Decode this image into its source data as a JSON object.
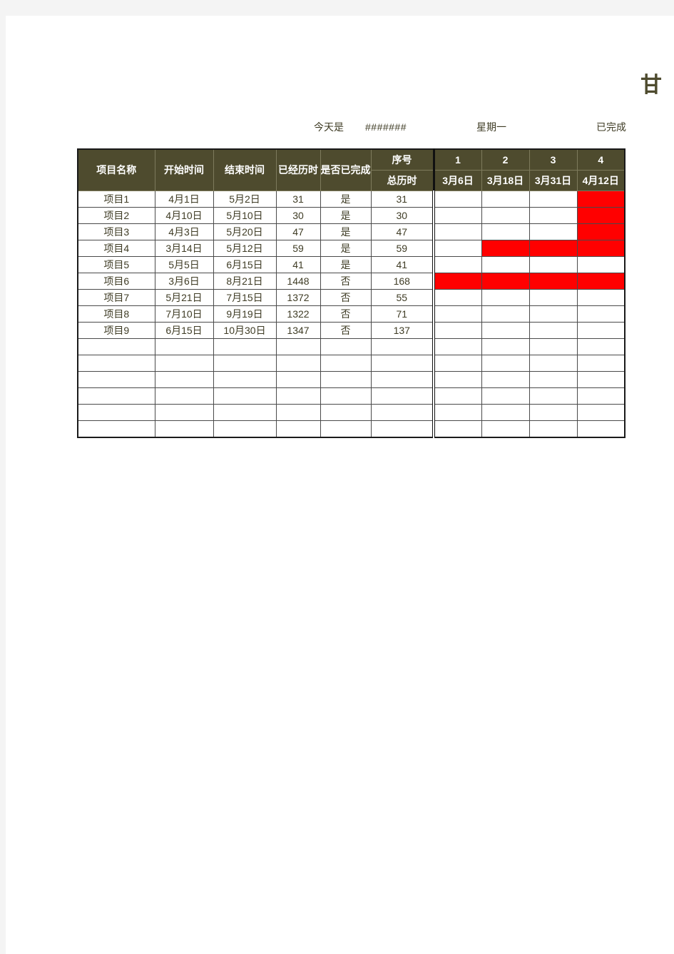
{
  "title": "甘",
  "info": {
    "today_label": "今天是",
    "today_value": "#######",
    "weekday": "星期一",
    "legend_done": "已完成"
  },
  "table": {
    "headers_top": [
      "项目名称",
      "开始时间",
      "结束时间",
      "已经历时",
      "是否已完成",
      "序号"
    ],
    "header_total_label": "总历时",
    "gantt_index": [
      "1",
      "2",
      "3",
      "4"
    ],
    "gantt_dates": [
      "3月6日",
      "3月18日",
      "3月31日",
      "4月12日"
    ],
    "rows": [
      {
        "name": "项目1",
        "start": "4月1日",
        "end": "5月2日",
        "elapsed": "31",
        "done": "是",
        "total": "31",
        "bars": [
          0,
          0,
          0,
          1
        ]
      },
      {
        "name": "项目2",
        "start": "4月10日",
        "end": "5月10日",
        "elapsed": "30",
        "done": "是",
        "total": "30",
        "bars": [
          0,
          0,
          0,
          1
        ]
      },
      {
        "name": "项目3",
        "start": "4月3日",
        "end": "5月20日",
        "elapsed": "47",
        "done": "是",
        "total": "47",
        "bars": [
          0,
          0,
          0,
          1
        ]
      },
      {
        "name": "项目4",
        "start": "3月14日",
        "end": "5月12日",
        "elapsed": "59",
        "done": "是",
        "total": "59",
        "bars": [
          0,
          1,
          1,
          1
        ]
      },
      {
        "name": "项目5",
        "start": "5月5日",
        "end": "6月15日",
        "elapsed": "41",
        "done": "是",
        "total": "41",
        "bars": [
          0,
          0,
          0,
          0
        ]
      },
      {
        "name": "项目6",
        "start": "3月6日",
        "end": "8月21日",
        "elapsed": "1448",
        "done": "否",
        "total": "168",
        "bars": [
          1,
          1,
          1,
          1
        ]
      },
      {
        "name": "项目7",
        "start": "5月21日",
        "end": "7月15日",
        "elapsed": "1372",
        "done": "否",
        "total": "55",
        "bars": [
          0,
          0,
          0,
          0
        ]
      },
      {
        "name": "项目8",
        "start": "7月10日",
        "end": "9月19日",
        "elapsed": "1322",
        "done": "否",
        "total": "71",
        "bars": [
          0,
          0,
          0,
          0
        ]
      },
      {
        "name": "项目9",
        "start": "6月15日",
        "end": "10月30日",
        "elapsed": "1347",
        "done": "否",
        "total": "137",
        "bars": [
          0,
          0,
          0,
          0
        ]
      },
      {
        "name": "",
        "start": "",
        "end": "",
        "elapsed": "",
        "done": "",
        "total": "",
        "bars": [
          0,
          0,
          0,
          0
        ]
      },
      {
        "name": "",
        "start": "",
        "end": "",
        "elapsed": "",
        "done": "",
        "total": "",
        "bars": [
          0,
          0,
          0,
          0
        ]
      },
      {
        "name": "",
        "start": "",
        "end": "",
        "elapsed": "",
        "done": "",
        "total": "",
        "bars": [
          0,
          0,
          0,
          0
        ]
      },
      {
        "name": "",
        "start": "",
        "end": "",
        "elapsed": "",
        "done": "",
        "total": "",
        "bars": [
          0,
          0,
          0,
          0
        ]
      },
      {
        "name": "",
        "start": "",
        "end": "",
        "elapsed": "",
        "done": "",
        "total": "",
        "bars": [
          0,
          0,
          0,
          0
        ]
      },
      {
        "name": "",
        "start": "",
        "end": "",
        "elapsed": "",
        "done": "",
        "total": "",
        "bars": [
          0,
          0,
          0,
          0
        ]
      }
    ]
  },
  "colors": {
    "header_bg": "#4e4b2e",
    "bar": "#ff0000",
    "text": "#3f3c25"
  }
}
